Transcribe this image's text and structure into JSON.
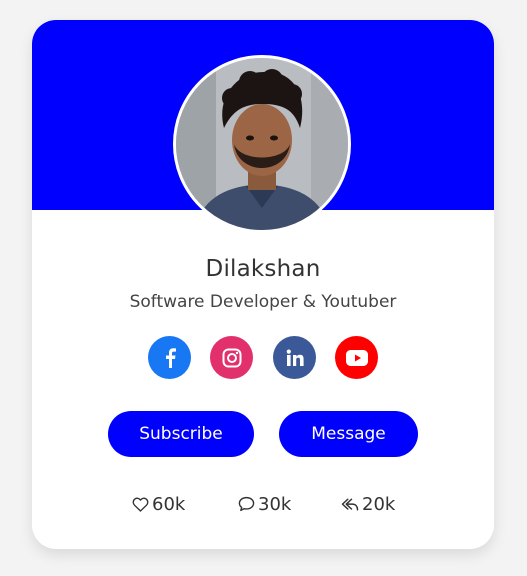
{
  "profile": {
    "name": "Dilakshan",
    "title": "Software Developer & Youtuber"
  },
  "social_icons": [
    {
      "icon": "facebook-icon",
      "color": "#1877f2"
    },
    {
      "icon": "instagram-icon",
      "color": "#e1306c"
    },
    {
      "icon": "linkedin-icon",
      "color": "#3b5998"
    },
    {
      "icon": "youtube-icon",
      "color": "#ff0000"
    }
  ],
  "buttons": {
    "subscribe_label": "Subscribe",
    "message_label": "Message"
  },
  "stats": {
    "likes": "60k",
    "comments": "30k",
    "shares": "20k"
  },
  "colors": {
    "accent": "#0000ff",
    "card_bg": "#ffffff",
    "page_bg": "#f3f3f3"
  }
}
